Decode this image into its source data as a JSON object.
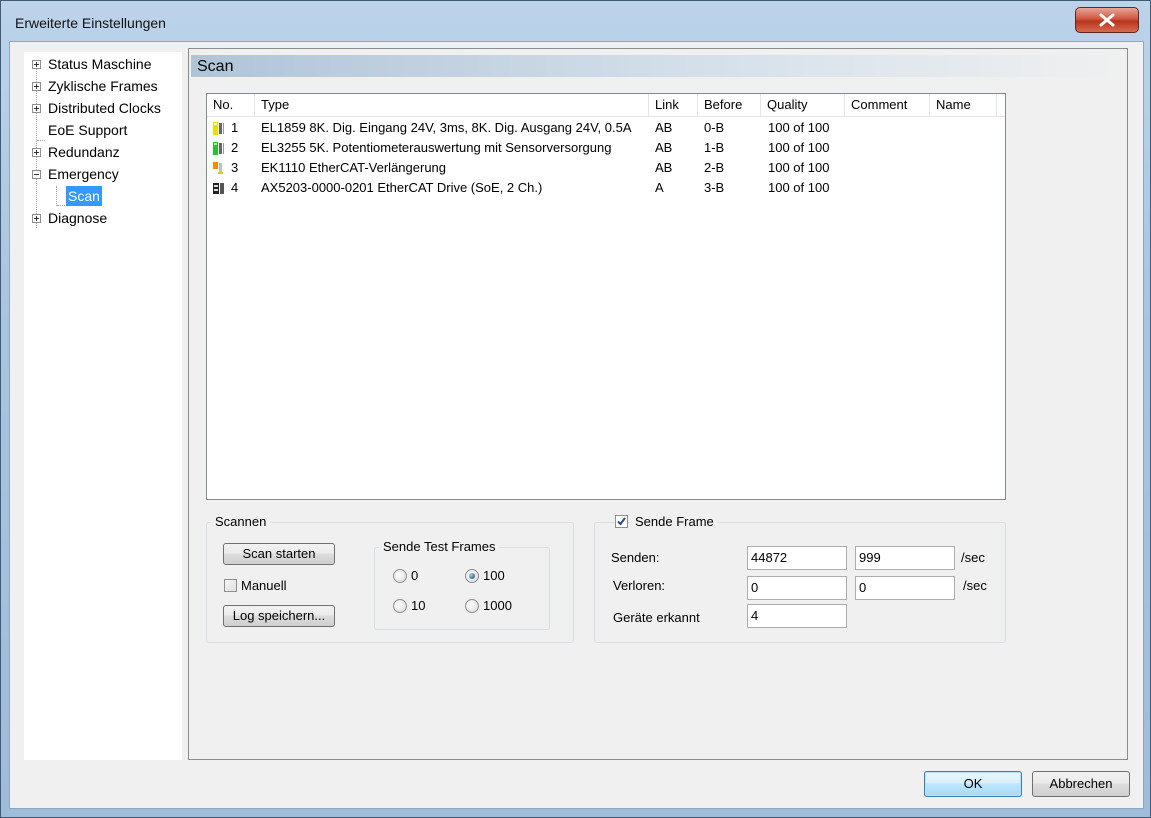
{
  "window": {
    "title": "Erweiterte Einstellungen"
  },
  "tree": {
    "items": [
      {
        "label": "Status Maschine"
      },
      {
        "label": "Zyklische Frames"
      },
      {
        "label": "Distributed Clocks"
      },
      {
        "label": "EoE Support"
      },
      {
        "label": "Redundanz"
      },
      {
        "label": "Emergency"
      },
      {
        "label": "Scan"
      },
      {
        "label": "Diagnose"
      }
    ]
  },
  "panel": {
    "title": "Scan"
  },
  "table": {
    "columns": [
      "No.",
      "Type",
      "Link",
      "Before",
      "Quality",
      "Comment",
      "Name"
    ],
    "rows": [
      {
        "no": "1",
        "type": "EL1859 8K. Dig. Eingang 24V, 3ms, 8K. Dig. Ausgang 24V, 0.5A",
        "link": "AB",
        "before": "0-B",
        "quality": "100 of 100",
        "comment": "",
        "name": "",
        "icon": "terminal-yellow-icon"
      },
      {
        "no": "2",
        "type": "EL3255 5K. Potentiometerauswertung mit Sensorversorgung",
        "link": "AB",
        "before": "1-B",
        "quality": "100 of 100",
        "comment": "",
        "name": "",
        "icon": "terminal-green-icon"
      },
      {
        "no": "3",
        "type": "EK1110 EtherCAT-Verlängerung",
        "link": "AB",
        "before": "2-B",
        "quality": "100 of 100",
        "comment": "",
        "name": "",
        "icon": "terminal-orange-icon"
      },
      {
        "no": "4",
        "type": "AX5203-0000-0201 EtherCAT Drive (SoE, 2 Ch.)",
        "link": "A",
        "before": "3-B",
        "quality": "100 of 100",
        "comment": "",
        "name": "",
        "icon": "drive-icon"
      }
    ]
  },
  "scannen": {
    "title": "Scannen",
    "scan_button": "Scan starten",
    "manuell_label": "Manuell",
    "manuell_checked": false,
    "log_button": "Log speichern...",
    "test_frames": {
      "title": "Sende Test Frames",
      "options": [
        "0",
        "100",
        "10",
        "1000"
      ],
      "selected": "100"
    }
  },
  "sende_frame": {
    "title": "Sende Frame",
    "checked": true,
    "senden_label": "Senden:",
    "senden_value1": "44872",
    "senden_value2": "999",
    "senden_unit": "/sec",
    "verloren_label": "Verloren:",
    "verloren_value1": "0",
    "verloren_value2": "0",
    "verloren_unit": "/sec",
    "geraete_label": "Geräte erkannt",
    "geraete_value": "4"
  },
  "footer": {
    "ok": "OK",
    "cancel": "Abbrechen"
  }
}
